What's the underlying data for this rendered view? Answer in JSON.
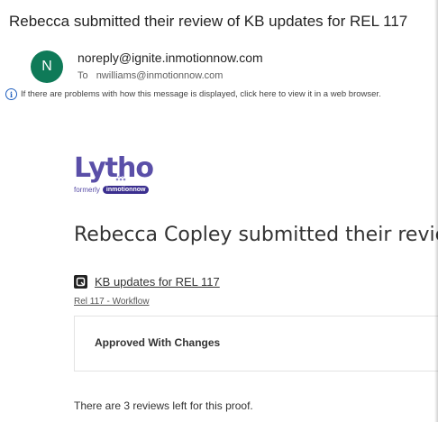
{
  "email": {
    "subject": "Rebecca submitted their review of KB updates for REL 117",
    "sender_initial": "N",
    "sender_address": "noreply@ignite.inmotionnow.com",
    "to_label": "To",
    "to_address": "nwilliams@inmotionnow.com",
    "info_notice": "If there are problems with how this message is displayed, click here to view it in a web browser."
  },
  "logo": {
    "brand": "Lytho",
    "formerly_label": "formerly",
    "formerly_brand": "inmotionnow"
  },
  "body": {
    "heading": "Rebecca Copley submitted their review:",
    "proof_title": "KB updates for REL 117",
    "workflow_link": "Rel 117 - Workflow",
    "status": "Approved With Changes",
    "reviews_left": "There are 3 reviews left for this proof."
  },
  "colors": {
    "avatar_bg": "#0f7a58",
    "brand_purple": "#5a4fa8",
    "info_blue": "#1f5fbf"
  }
}
